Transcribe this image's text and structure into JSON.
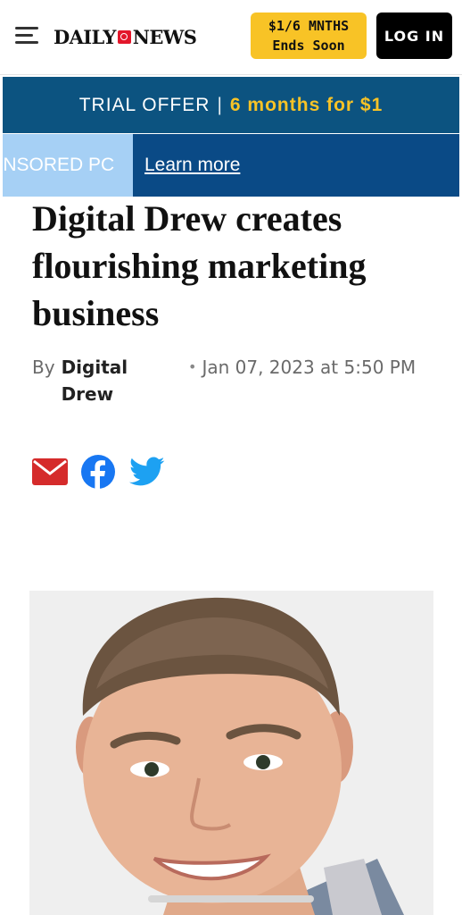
{
  "header": {
    "logo_left": "DAILY",
    "logo_right": "NEWS",
    "promo_line1": "$1/6 MNTHS",
    "promo_line2": "Ends Soon",
    "login_label": "LOG IN",
    "colors": {
      "promo": "#f8c326",
      "login": "#000000",
      "logo_mark": "#e3172b"
    }
  },
  "trial_banner": {
    "label": "TRIAL OFFER",
    "separator": "|",
    "offer": "6 months for $1",
    "colors": {
      "background": "#0c5380",
      "accent": "#f8c326"
    }
  },
  "sponsored": {
    "tag_text": "ONSORED PC",
    "link_text": "Learn more",
    "colors": {
      "bar": "#0a4a86",
      "tag": "#a6d0f5"
    }
  },
  "article": {
    "headline": "Digital Drew creates flourishing marketing business",
    "byline_prefix": "By",
    "author": "Digital Drew",
    "date_bullet": "•",
    "date": "Jan 07, 2023 at 5:50 PM"
  },
  "share": {
    "icons": [
      "email-icon",
      "facebook-icon",
      "twitter-icon"
    ],
    "colors": {
      "email": "#d52b2b",
      "facebook": "#1877f2",
      "twitter": "#1da1f2"
    }
  },
  "photo": {
    "subject": "portrait of smiling man"
  }
}
